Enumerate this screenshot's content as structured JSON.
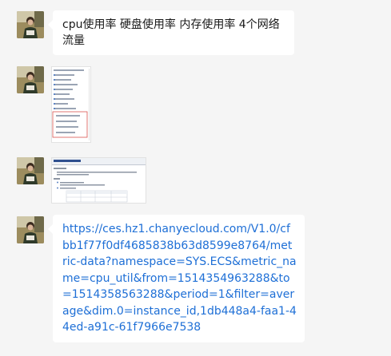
{
  "messages": [
    {
      "type": "text",
      "text": "cpu使用率 硬盘使用率 内存使用率 4个网络流量"
    },
    {
      "type": "image",
      "image_icon": "directory-tree-screenshot-thumbnail"
    },
    {
      "type": "image",
      "image_icon": "api-document-screenshot-thumbnail"
    },
    {
      "type": "text",
      "text": "https://ces.hz1.chanyecloud.com/V1.0/cfbb1f77f0df4685838b63d8599e8764/metric-data?namespace=SYS.ECS&metric_name=cpu_util&from=1514354963288&to=1514358563288&period=1&filter=average&dim.0=instance_id,1db448a4-faa1-44ed-a91c-61f7966e7538"
    }
  ],
  "colors": {
    "background": "#f5f5f5",
    "bubble": "#ffffff",
    "link": "#1e6fd6",
    "text": "#1a1a1a"
  }
}
